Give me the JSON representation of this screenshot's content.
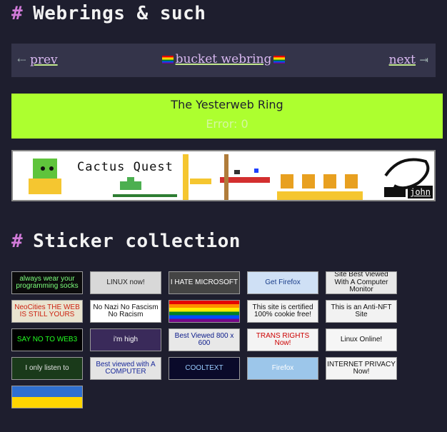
{
  "webrings": {
    "title_hash": "#",
    "title_text": "Webrings & such",
    "bucket": {
      "prev_arrow": "⇠",
      "prev": "prev",
      "center": "bucket webring",
      "next": "next",
      "next_arrow": "⇥"
    },
    "yesterweb": {
      "title": "The Yesterweb Ring",
      "error": "Error: 0"
    },
    "banner": {
      "title": "Cactus Quest",
      "credit": "john"
    }
  },
  "stickers": {
    "title_hash": "#",
    "title_text": "Sticker collection",
    "items": [
      {
        "text": "always wear your programming socks",
        "bg": "#0b0b0b",
        "fg": "#7cff7c"
      },
      {
        "text": "LINUX now!",
        "bg": "#d8d8d8",
        "fg": "#222"
      },
      {
        "text": "I HATE MICROSOFT",
        "bg": "#444",
        "fg": "#fff"
      },
      {
        "text": "Get Firefox",
        "bg": "#cfe0f5",
        "fg": "#1a3e8a"
      },
      {
        "text": "Site Best Viewed With A Computer Monitor",
        "bg": "#e8e8e8",
        "fg": "#111"
      },
      {
        "text": "NeoCities THE WEB IS STILL YOURS",
        "bg": "#e9e4d0",
        "fg": "#c21"
      },
      {
        "text": "No Nazi No Fascism No Racism",
        "bg": "#fff",
        "fg": "#111"
      },
      {
        "text": "",
        "bg": "rainbow",
        "fg": "#fff"
      },
      {
        "text": "This site is certified 100% cookie free!",
        "bg": "#f2f2f2",
        "fg": "#111"
      },
      {
        "text": "This is an Anti-NFT Site",
        "bg": "#f2f2f2",
        "fg": "#111"
      },
      {
        "text": "SAY NO TO WEB3",
        "bg": "#000",
        "fg": "#2f2"
      },
      {
        "text": "i'm high",
        "bg": "#3a2a5a",
        "fg": "#fff"
      },
      {
        "text": "Best Viewed 800 x 600",
        "bg": "#e8e8e8",
        "fg": "#0a1a8a"
      },
      {
        "text": "TRANS RIGHTS Now!",
        "bg": "#f4f4f4",
        "fg": "#c00"
      },
      {
        "text": "Linux Online!",
        "bg": "#f6f6f6",
        "fg": "#111"
      },
      {
        "text": "I only listen to",
        "bg": "#1a3a1a",
        "fg": "#e0e0e0"
      },
      {
        "text": "Best viewed with A COMPUTER",
        "bg": "#e4e4e4",
        "fg": "#1a2a9a"
      },
      {
        "text": "COOLTEXT",
        "bg": "#0a0a2a",
        "fg": "#9cf"
      },
      {
        "text": "Firefox",
        "bg": "#9cc6ea",
        "fg": "#fff"
      },
      {
        "text": "INTERNET PRIVACY Now!",
        "bg": "#f4f4f4",
        "fg": "#111"
      },
      {
        "text": "",
        "bg": "ukraine",
        "fg": "#fff"
      }
    ]
  }
}
